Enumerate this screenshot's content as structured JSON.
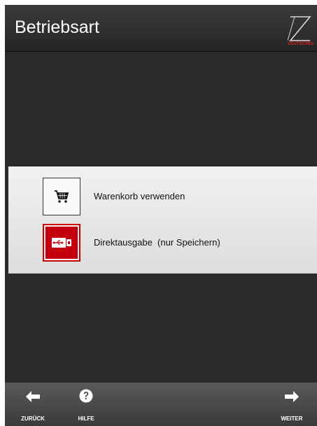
{
  "header": {
    "title": "Betriebsart",
    "logo_text": "ZEUTSCHEL"
  },
  "options": [
    {
      "label": "Warenkorb verwenden",
      "icon": "shopping-cart-icon",
      "selected": false
    },
    {
      "label": "Direktausgabe  (nur Speichern)",
      "icon": "usb-drive-icon",
      "selected": true
    }
  ],
  "footer": {
    "back_label": "ZURÜCK",
    "help_label": "HILFE",
    "next_label": "WEITER"
  },
  "colors": {
    "background": "#2b2b2b",
    "accent": "#c4000f",
    "panel": "#e8e8e8",
    "header": "#303030",
    "footer": "#4a4a4a"
  }
}
